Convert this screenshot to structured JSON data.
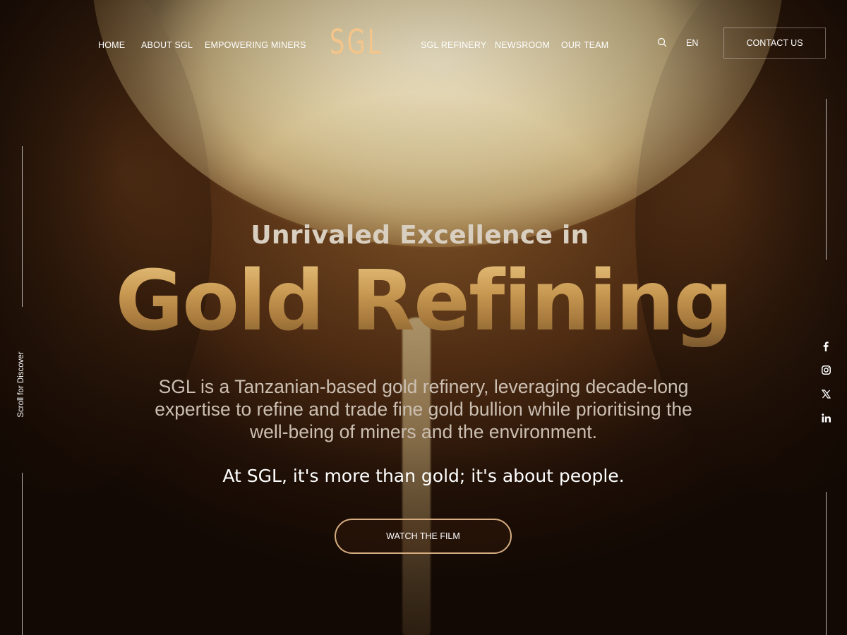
{
  "nav": {
    "left": [
      "HOME",
      "ABOUT SGL",
      "EMPOWERING MINERS"
    ],
    "logo": "SGL",
    "right": [
      "SGL REFINERY",
      "NEWSROOM",
      "OUR TEAM"
    ],
    "lang": "EN",
    "contact": "CONTACT US"
  },
  "side": {
    "scroll_label": "Scroll for Discover",
    "socials": [
      "facebook-icon",
      "instagram-icon",
      "x-icon",
      "linkedin-icon"
    ]
  },
  "hero": {
    "eyebrow": "Unrivaled Excellence in",
    "title": "Gold Refining",
    "description": "SGL is a Tanzanian-based gold refinery, leveraging decade-long expertise to refine and trade fine gold bullion while prioritising the well-being of miners and the environment.",
    "tagline": "At SGL, it's more than gold; it's about people.",
    "cta": "WATCH THE FILM"
  },
  "colors": {
    "logo": "#f3c58a",
    "button_border": "#d6ad80",
    "title_gold": "#c99a53"
  }
}
